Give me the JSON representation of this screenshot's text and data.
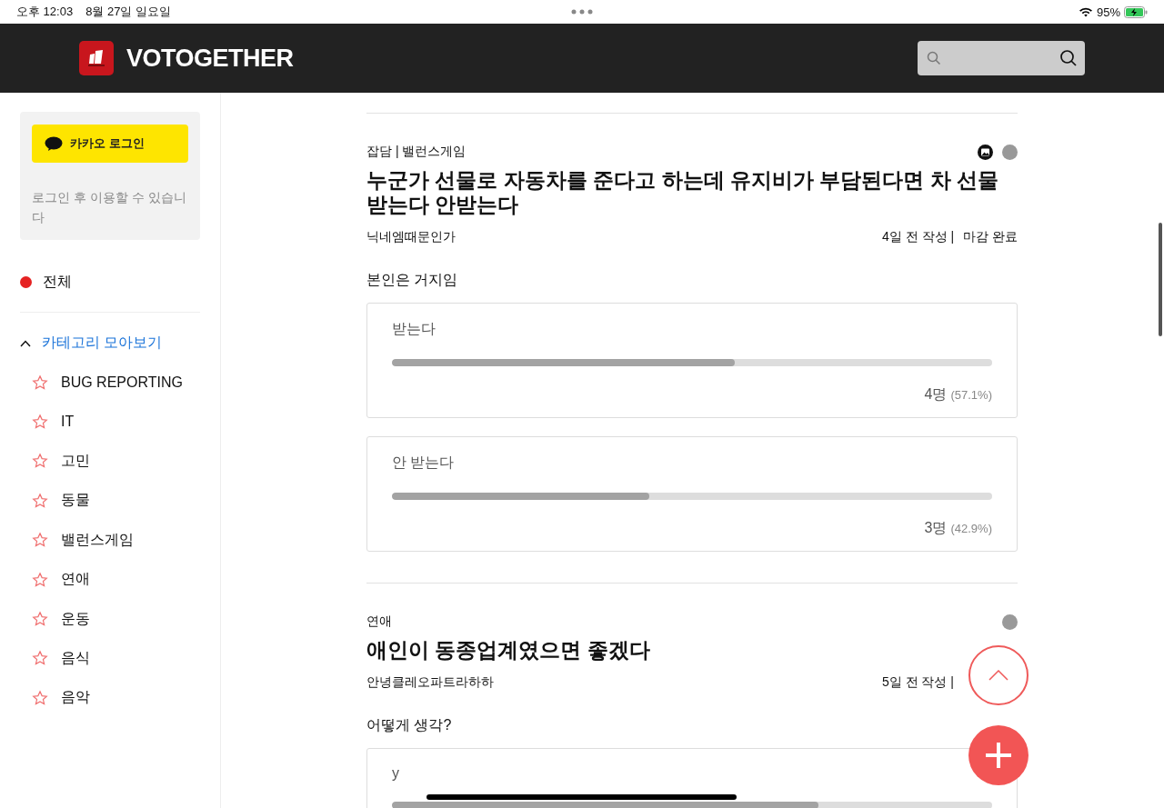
{
  "status_bar": {
    "time": "오후 12:03",
    "date": "8월 27일 일요일",
    "battery": "95%"
  },
  "header": {
    "logo": "VOTOGETHER"
  },
  "sidebar": {
    "login_button": "카카오 로그인",
    "login_note": "로그인 후 이용할 수 있습니다",
    "all": {
      "label": "전체",
      "selected": true
    },
    "categories": {
      "label": "카테고리 모아보기",
      "expanded": true,
      "items": [
        {
          "label": "BUG REPORTING",
          "favorite": false
        },
        {
          "label": "IT",
          "favorite": false
        },
        {
          "label": "고민",
          "favorite": false
        },
        {
          "label": "동물",
          "favorite": false
        },
        {
          "label": "밸런스게임",
          "favorite": false
        },
        {
          "label": "연애",
          "favorite": false
        },
        {
          "label": "운동",
          "favorite": false
        },
        {
          "label": "음식",
          "favorite": false
        },
        {
          "label": "음악",
          "favorite": false
        }
      ]
    }
  },
  "posts": [
    {
      "category": "잡담 | 밸런스게임",
      "has_image": true,
      "title": "누군가 선물로 자동차를 준다고 하는데 유지비가 부담된다면 차 선물 받는다 안받는다",
      "author": "닉네엠때문인가",
      "time": "4일 전 작성 |",
      "status": "마감 완료",
      "question": "본인은 거지임",
      "options": [
        {
          "label": "받는다",
          "level": 0.571,
          "count": "4명",
          "percent": "(57.1%)"
        },
        {
          "label": "안 받는다",
          "level": 0.429,
          "count": "3명",
          "percent": "(42.9%)"
        }
      ]
    },
    {
      "category": "연애",
      "has_image": false,
      "title": "애인이 동종업계였으면 좋겠다",
      "author": "안녕클레오파트라하하",
      "time": "5일 전 작성 |",
      "question": "어떻게 생각?",
      "options": [
        {
          "label": "y",
          "level": 0.71
        }
      ]
    }
  ]
}
